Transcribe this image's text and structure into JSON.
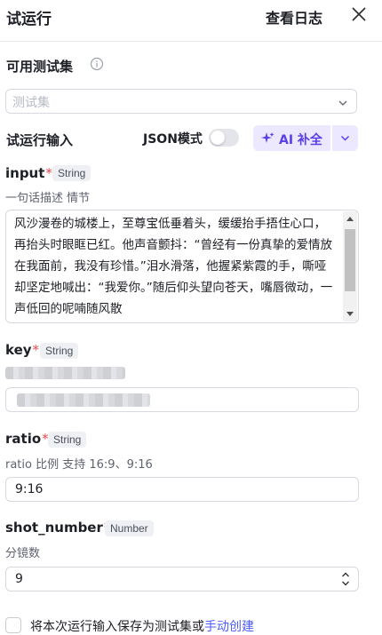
{
  "header": {
    "title": "试运行",
    "view_log": "查看日志"
  },
  "test_sets": {
    "label": "可用测试集",
    "placeholder": "测试集"
  },
  "run_input": {
    "label": "试运行输入",
    "json_mode_label": "JSON模式",
    "json_mode_on": false,
    "ai_button_label": "AI 补全"
  },
  "fields": {
    "input": {
      "name": "input",
      "required": "*",
      "type": "String",
      "description": "一句话描述 情节",
      "value": "风沙漫卷的城楼上，至尊宝低垂着头，缓缓抬手捂住心口，再抬头时眼眶已红。他声音颤抖：“曾经有一份真挚的爱情放在我面前，我没有珍惜。”泪水滑落，他握紧紫霞的手，嘶哑却坚定地喊出：“我爱你。”随后仰头望向苍天，嘴唇微动，一声低回的呢喃随风散"
    },
    "key": {
      "name": "key",
      "required": "*",
      "type": "String"
    },
    "ratio": {
      "name": "ratio",
      "required": "*",
      "type": "String",
      "description": "ratio 比例 支持 16:9、9:16",
      "value": "9:16"
    },
    "shot_number": {
      "name": "shot_number",
      "required": "*",
      "type": "Number",
      "description": "分镜数",
      "value": "9"
    }
  },
  "footer": {
    "save_text": "将本次运行输入保存为测试集或",
    "link_text": "手动创建"
  },
  "colors": {
    "accent": "#5b3ee8",
    "ai_bg": "#ece8ff",
    "required": "#e5484d",
    "link": "#4b5cff"
  }
}
